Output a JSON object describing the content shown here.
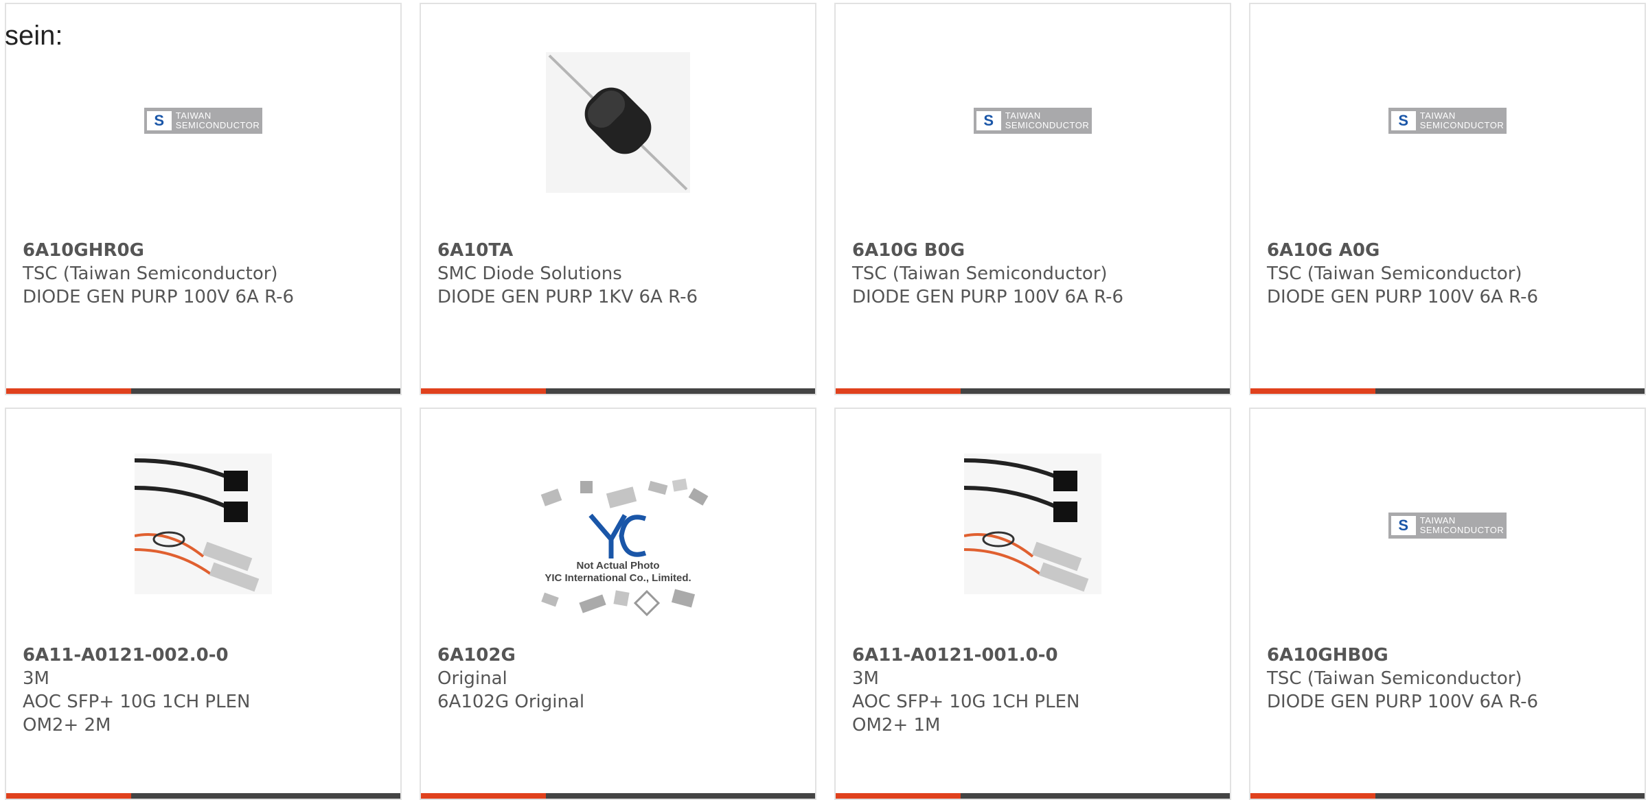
{
  "intro_text": "sein:",
  "colors": {
    "accent": "#e0411d",
    "bar": "#444444",
    "border": "#e2e2e2",
    "tsc_blue": "#1a56a8",
    "logo_grey": "#a9a9ab"
  },
  "cards": [
    {
      "part": "6A10GHR0G",
      "mfr": "TSC (Taiwan Semiconductor)",
      "desc": "DIODE GEN PURP 100V 6A R-6",
      "image": "tsc-logo"
    },
    {
      "part": "6A10TA",
      "mfr": "SMC Diode Solutions",
      "desc": "DIODE GEN PURP 1KV 6A R-6",
      "image": "diode-photo"
    },
    {
      "part": "6A10G B0G",
      "mfr": "TSC (Taiwan Semiconductor)",
      "desc": "DIODE GEN PURP 100V 6A R-6",
      "image": "tsc-logo"
    },
    {
      "part": "6A10G A0G",
      "mfr": "TSC (Taiwan Semiconductor)",
      "desc": "DIODE GEN PURP 100V 6A R-6",
      "image": "tsc-logo"
    },
    {
      "part": "6A11-A0121-002.0-0",
      "mfr": "3M",
      "desc": "AOC SFP+ 10G 1CH PLEN OM2+ 2M",
      "image": "cable-photo"
    },
    {
      "part": "6A102G",
      "mfr": "Original",
      "desc": "6A102G Original",
      "image": "yic-placeholder"
    },
    {
      "part": "6A11-A0121-001.0-0",
      "mfr": "3M",
      "desc": "AOC SFP+ 10G 1CH PLEN OM2+ 1M",
      "image": "cable-photo"
    },
    {
      "part": "6A10GHB0G",
      "mfr": "TSC (Taiwan Semiconductor)",
      "desc": "DIODE GEN PURP 100V 6A R-6",
      "image": "tsc-logo"
    }
  ],
  "tsc_logo": {
    "mark": "S",
    "line1": "TAIWAN",
    "line2": "SEMICONDUCTOR"
  },
  "yic": {
    "line1": "Not Actual Photo",
    "line2": "YIC International Co., Limited."
  }
}
